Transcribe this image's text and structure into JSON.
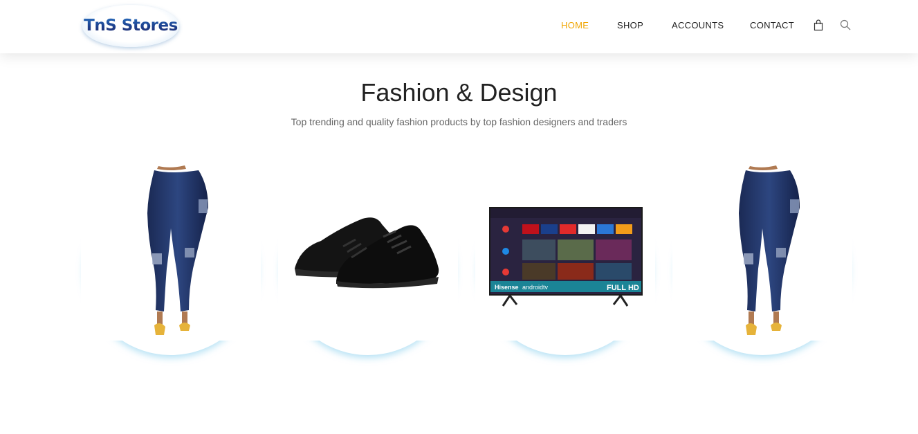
{
  "brand": {
    "logo_text": "TnS Stores"
  },
  "nav": {
    "items": [
      {
        "label": "HOME",
        "active": true
      },
      {
        "label": "SHOP",
        "active": false
      },
      {
        "label": "ACCOUNTS",
        "active": false
      },
      {
        "label": "CONTACT",
        "active": false
      }
    ],
    "icons": [
      "shopping-bag-icon",
      "search-icon"
    ]
  },
  "colors": {
    "accent": "#f0a500",
    "glow": "#78c8eb",
    "text": "#222222",
    "muted": "#666666"
  },
  "hero": {
    "title": "Fashion & Design",
    "subtitle": "Top trending and quality fashion products by top fashion designers and traders"
  },
  "products": [
    {
      "image": "jeans-image"
    },
    {
      "image": "sneakers-image"
    },
    {
      "image": "tv-image",
      "tv_brand": "Hisense",
      "tv_os": "androidtv",
      "tv_badge": "FULL HD"
    },
    {
      "image": "jeans-image"
    }
  ]
}
